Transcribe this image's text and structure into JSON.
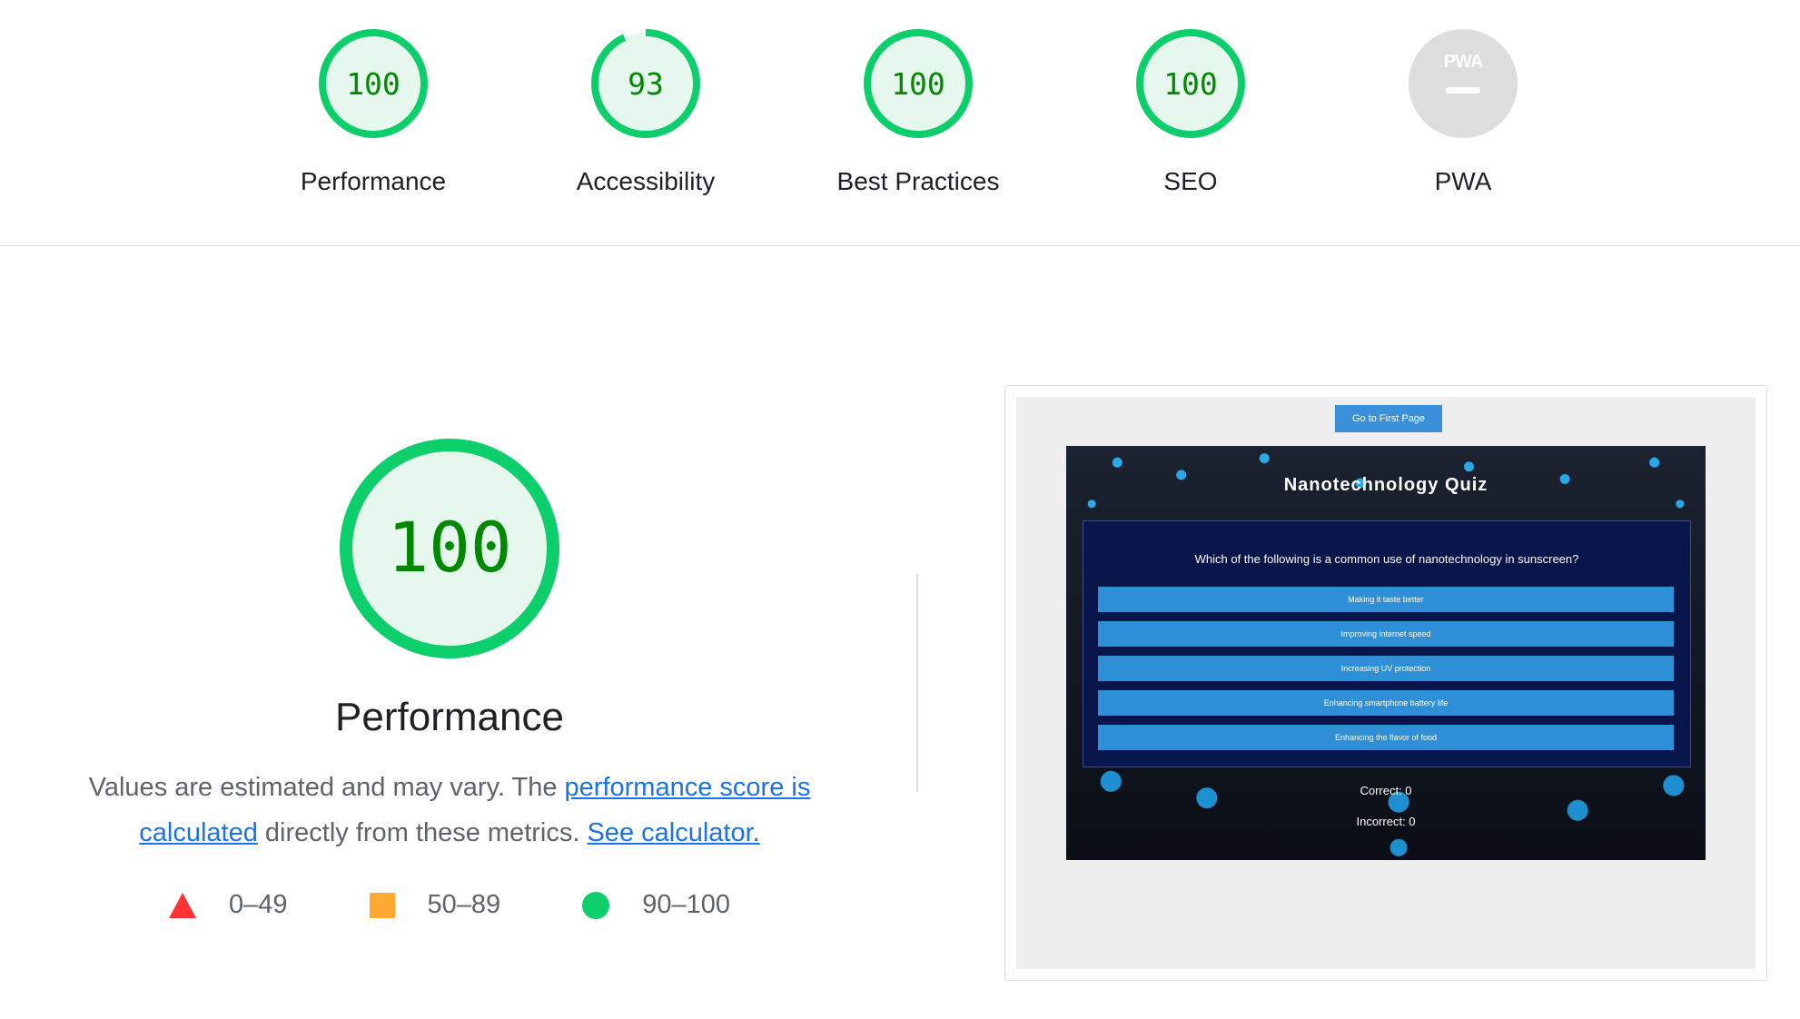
{
  "categories": [
    {
      "label": "Performance",
      "score": "100",
      "value": 100
    },
    {
      "label": "Accessibility",
      "score": "93",
      "value": 93
    },
    {
      "label": "Best Practices",
      "score": "100",
      "value": 100
    },
    {
      "label": "SEO",
      "score": "100",
      "value": 100
    },
    {
      "label": "PWA",
      "badge": "PWA",
      "score": "—",
      "value": null
    }
  ],
  "colors": {
    "pass": "#0cce6b",
    "pass_bg": "#e6f8ee",
    "pass_text": "#008800",
    "fail": "#ff3333",
    "average": "#ffaa33",
    "neutral": "#dddddd",
    "link": "#1a73e8"
  },
  "performance": {
    "score": "100",
    "value": 100,
    "title": "Performance",
    "desc_start": "Values are estimated and may vary. The ",
    "link1": "performance score is calculated",
    "desc_mid": " directly from these metrics. ",
    "link2": "See calculator.",
    "legend": [
      {
        "range": "0–49",
        "icon": "triangle-icon"
      },
      {
        "range": "50–89",
        "icon": "square-icon"
      },
      {
        "range": "90–100",
        "icon": "circle-icon"
      }
    ]
  },
  "screenshot": {
    "first_page_button": "Go to First Page",
    "quiz_title": "Nanotechnology Quiz",
    "question": "Which of the following is a common use of nanotechnology in sunscreen?",
    "answers": [
      "Making it taste better",
      "Improving internet speed",
      "Increasing UV protection",
      "Enhancing smartphone battery life",
      "Enhancing the flavor of food"
    ],
    "correct": "Correct: 0",
    "incorrect": "Incorrect: 0"
  }
}
